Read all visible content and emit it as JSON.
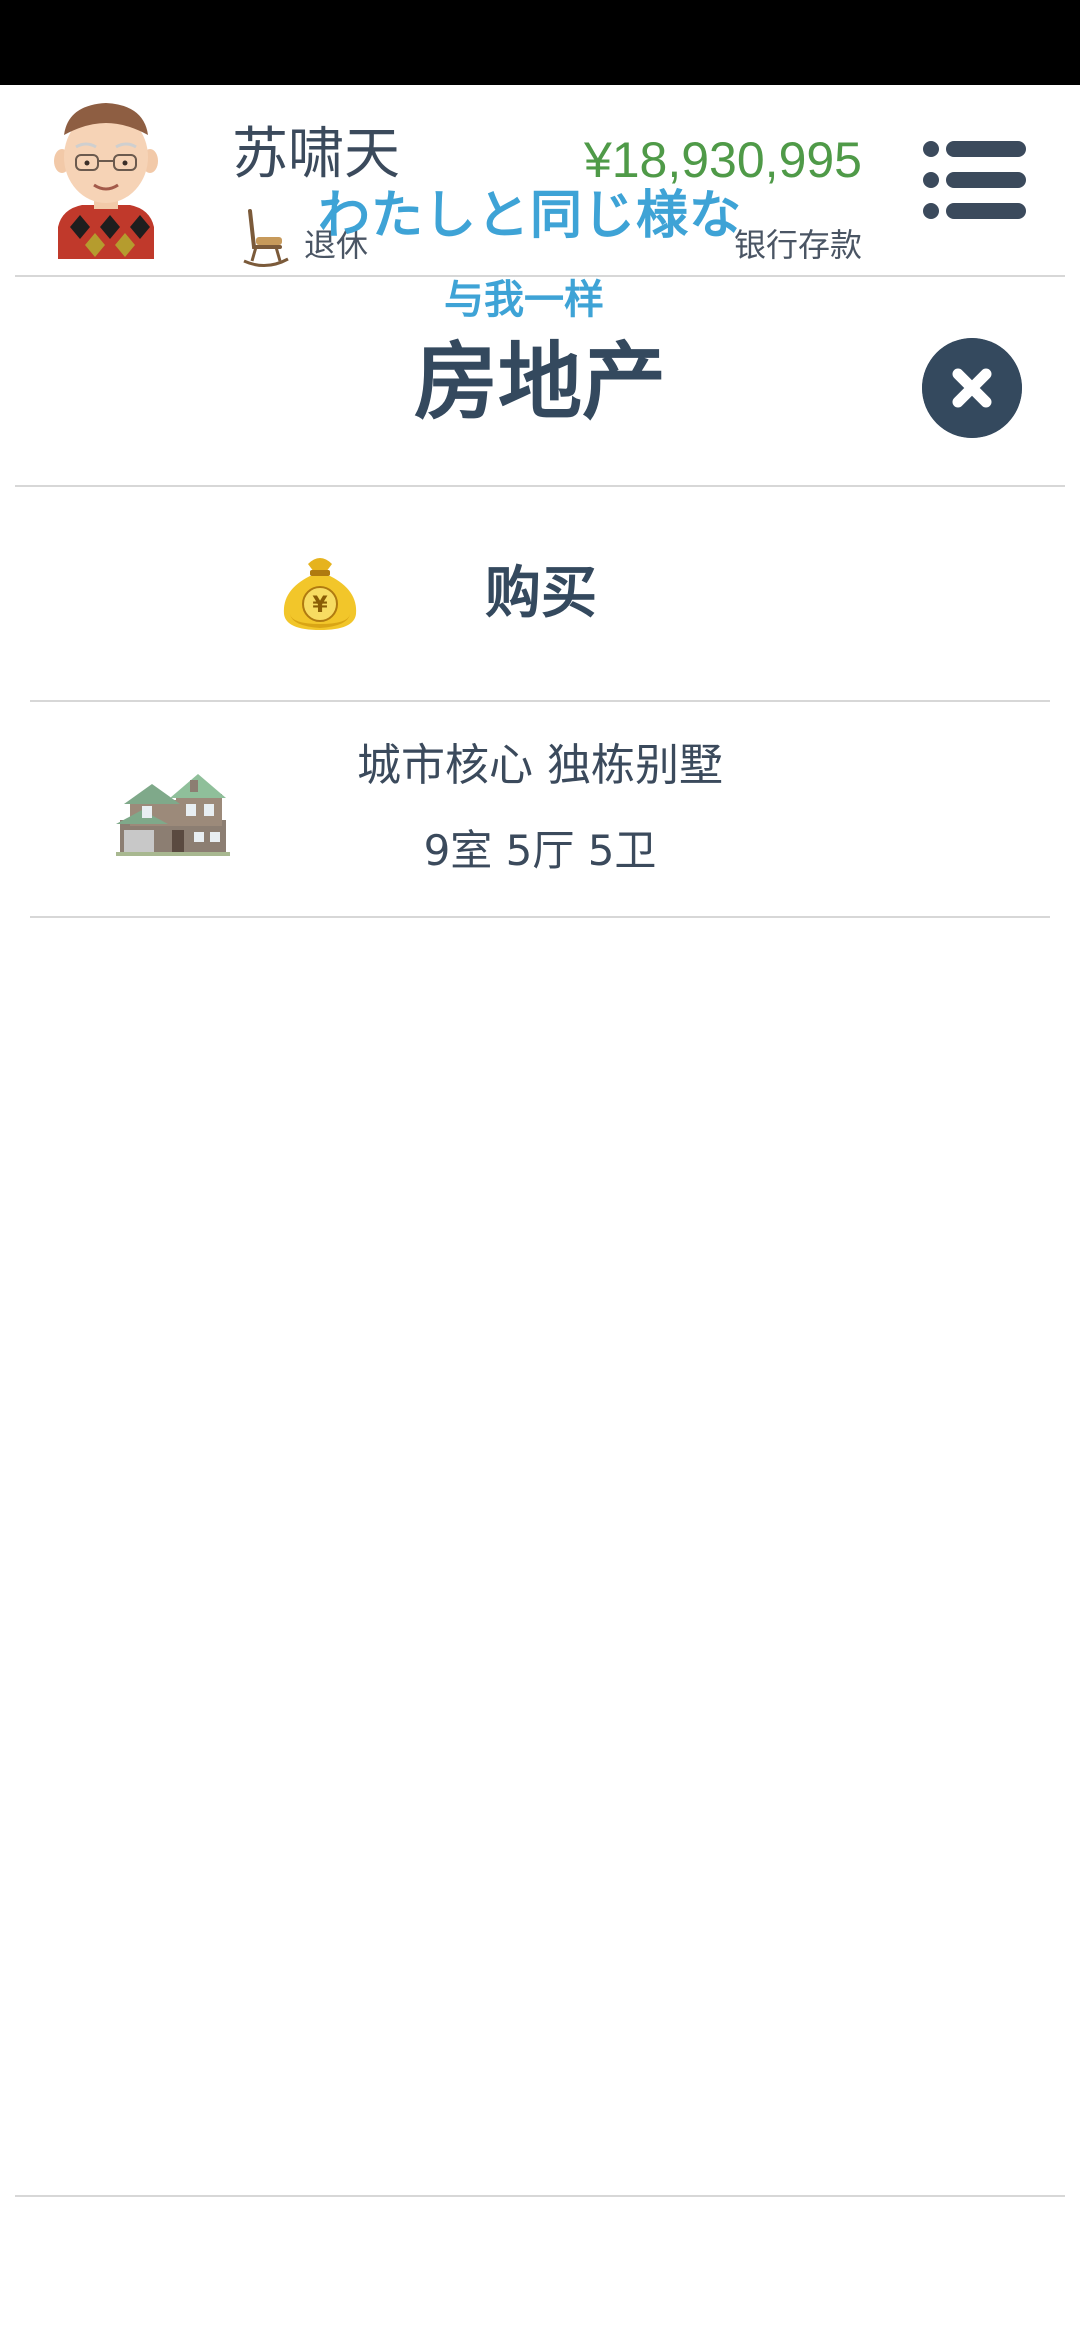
{
  "header": {
    "player_name": "苏啸天",
    "status": "退休",
    "money": "¥18,930,995",
    "money_label": "银行存款"
  },
  "overlay": {
    "japanese": "わたしと同じ様な",
    "chinese": "与我一样"
  },
  "page": {
    "title": "房地产"
  },
  "actions": {
    "buy_label": "购买"
  },
  "properties": [
    {
      "name": "城市核心 独栋别墅",
      "rooms": "9室 5厅 5卫"
    }
  ],
  "colors": {
    "money": "#4f9a48",
    "title": "#34495e",
    "overlay": "#3ea3d6",
    "divider": "#d7d7d7"
  },
  "icons": {
    "avatar": "elderly-man-avatar",
    "status": "rocking-chair-icon",
    "menu": "list-menu-icon",
    "close": "close-icon",
    "buy": "money-bag-icon",
    "property": "house-icon"
  }
}
